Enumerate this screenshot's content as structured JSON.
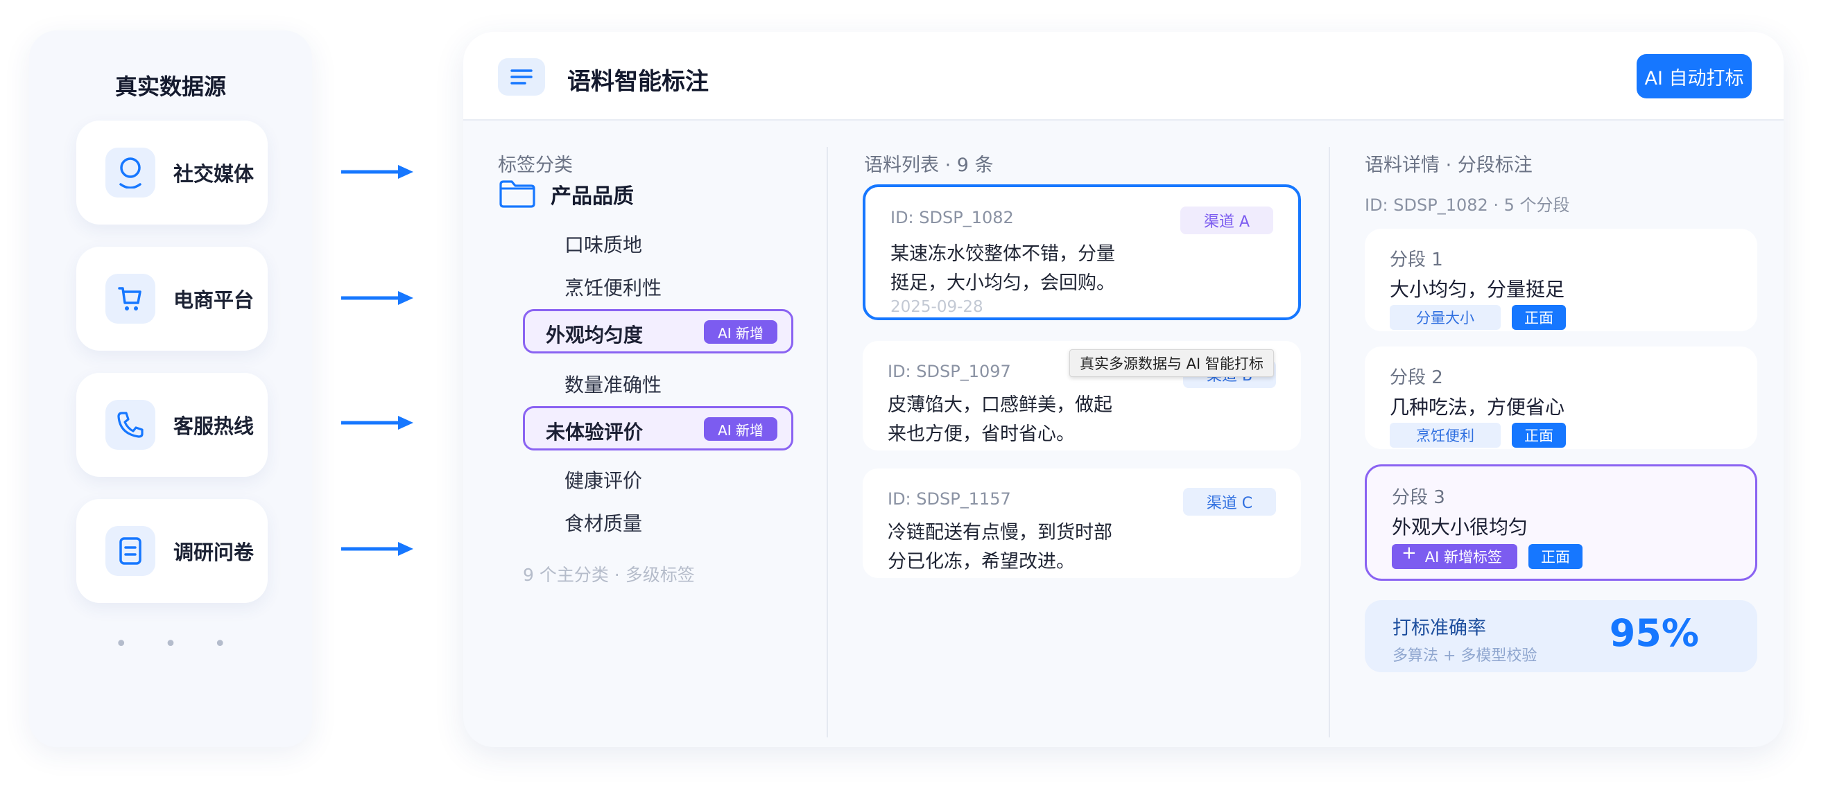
{
  "sources": {
    "title": "真实数据源",
    "items": [
      {
        "label": "社交媒体",
        "icon": "user-icon"
      },
      {
        "label": "电商平台",
        "icon": "cart-icon"
      },
      {
        "label": "客服热线",
        "icon": "phone-icon"
      },
      {
        "label": "调研问卷",
        "icon": "document-icon"
      }
    ],
    "more": "• • •"
  },
  "header": {
    "title": "语料智能标注",
    "ai_button": "AI 自动打标"
  },
  "tags": {
    "title": "标签分类",
    "category": "产品品质",
    "items": {
      "i1": "口味质地",
      "i2": "烹饪便利性",
      "i3": "外观均匀度",
      "i4": "数量准确性",
      "i5": "未体验评价",
      "i6": "健康评价",
      "i7": "食材质量"
    },
    "ai_badge": "AI 新增",
    "footer": "9 个主分类 · 多级标签"
  },
  "corpus": {
    "title": "语料列表 · 9 条",
    "items": [
      {
        "id": "ID: SDSP_1082",
        "channel": "渠道 A",
        "text": "某速冻水饺整体不错，分量挺足，大小均匀，会回购。",
        "date": "2025-09-28"
      },
      {
        "id": "ID: SDSP_1097",
        "channel": "渠道 B",
        "text": "皮薄馅大，口感鲜美，做起来也方便，省时省心。"
      },
      {
        "id": "ID: SDSP_1157",
        "channel": "渠道 C",
        "text": "冷链配送有点慢，到货时部分已化冻，希望改进。"
      }
    ],
    "tooltip": "真实多源数据与 AI 智能打标"
  },
  "detail": {
    "title": "语料详情 · 分段标注",
    "id_line": "ID: SDSP_1082 · 5 个分段",
    "segments": [
      {
        "title": "分段 1",
        "text": "大小均匀，分量挺足",
        "tag": "分量大小",
        "sentiment": "正面"
      },
      {
        "title": "分段 2",
        "text": "几种吃法，方便省心",
        "tag": "烹饪便利",
        "sentiment": "正面"
      },
      {
        "title": "分段 3",
        "text": "外观大小很均匀",
        "tag": "AI 新增标签",
        "sentiment": "正面"
      }
    ],
    "accuracy": {
      "title": "打标准确率",
      "sub": "多算法 + 多模型校验",
      "value": "95%"
    }
  },
  "colors": {
    "accent": "#1677ff",
    "ai_purple": "#7c5cf0"
  }
}
